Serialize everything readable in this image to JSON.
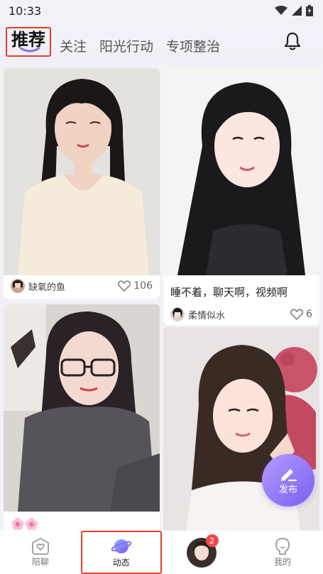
{
  "status_bar": {
    "time": "10:33"
  },
  "header": {
    "tabs": [
      {
        "label": "推荐",
        "active": true
      },
      {
        "label": "关注"
      },
      {
        "label": "阳光行动"
      },
      {
        "label": "专项整治"
      }
    ]
  },
  "feed": {
    "cards": [
      {
        "author": "缺氧的鱼",
        "likes": "106",
        "caption": ""
      },
      {
        "author": "柔情似水",
        "likes": "6",
        "caption": "睡不着，聊天啊，视频啊"
      },
      {
        "author": "",
        "likes": "",
        "caption": "",
        "emoji": "🌸🌸"
      },
      {
        "author": "",
        "likes": "",
        "caption": ""
      }
    ]
  },
  "fab": {
    "label": "发布"
  },
  "bottom_nav": {
    "items": [
      {
        "label": "陪聊"
      },
      {
        "label": "动态",
        "active": true
      },
      {
        "label": "",
        "badge": "2"
      },
      {
        "label": "我的"
      }
    ]
  },
  "colors": {
    "accent": "#8a6cf5",
    "highlight_box": "#e3412b",
    "badge": "#f04a4a"
  }
}
